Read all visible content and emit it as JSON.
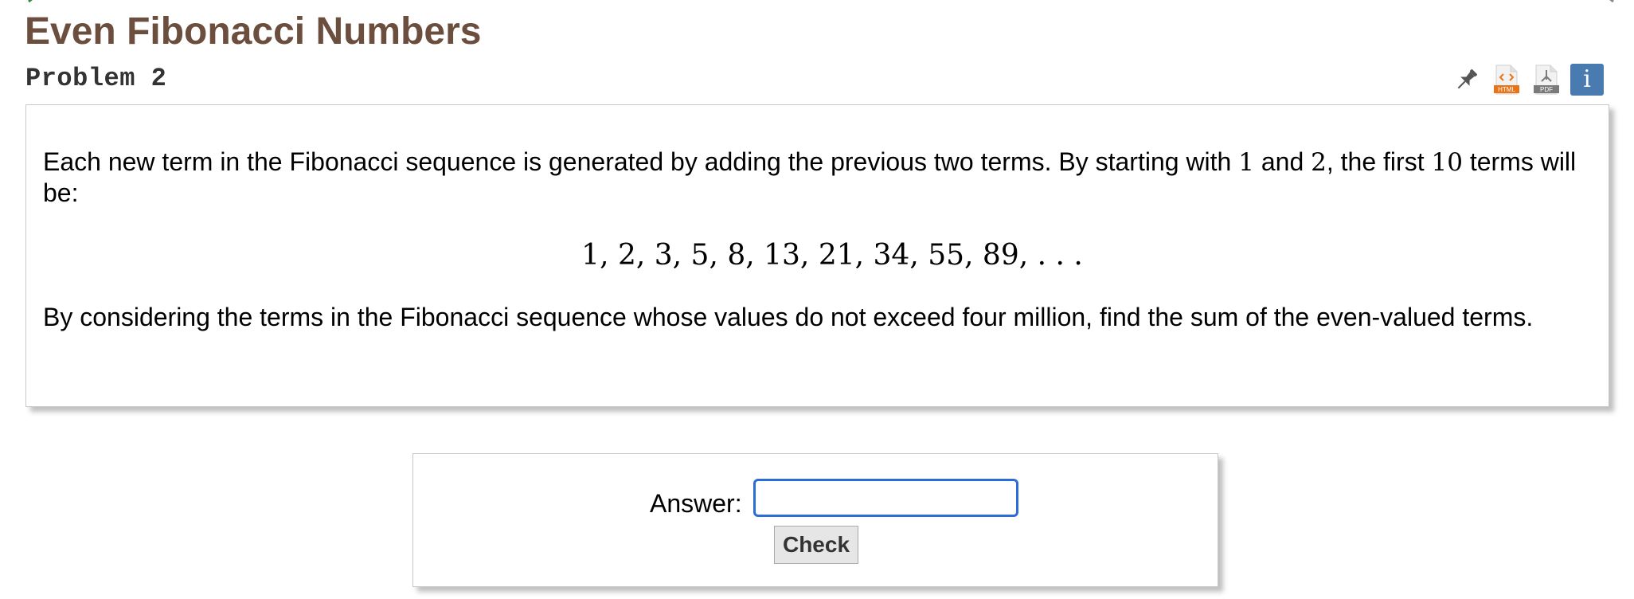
{
  "page": {
    "title": "Even Fibonacci Numbers",
    "problem_label": "Problem 2"
  },
  "toolbar": {
    "icons": [
      "pin-icon",
      "html-icon",
      "pdf-icon",
      "info-icon"
    ],
    "html_caption": "HTML",
    "pdf_caption": "PDF",
    "info_glyph": "i",
    "colors": {
      "title": "#6b4e3d",
      "html_icon": "#e8741a",
      "pdf_icon": "#7a7a7a",
      "info_bg": "#4a7bb0",
      "input_border": "#2b6cd6"
    }
  },
  "problem": {
    "intro_before_1": "Each new term in the Fibonacci sequence is generated by adding the previous two terms. By starting with ",
    "num_1": "1",
    "intro_and": " and ",
    "num_2": "2",
    "intro_first": ", the first ",
    "num_10": "10",
    "intro_end": " terms will be:",
    "sequence": "1, 2, 3, 5, 8, 13, 21, 34, 55, 89, . . .",
    "question": "By considering the terms in the Fibonacci sequence whose values do not exceed four million, find the sum of the even-valued terms."
  },
  "answer_form": {
    "label": "Answer:",
    "input_value": "",
    "check_label": "Check"
  }
}
